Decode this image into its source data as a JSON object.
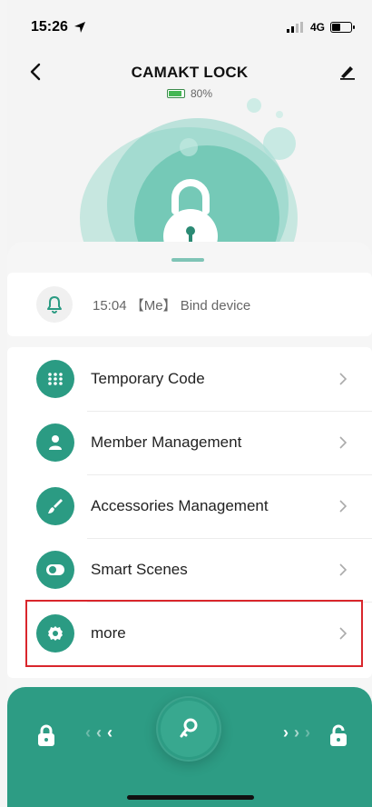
{
  "status": {
    "time": "15:26",
    "network": "4G"
  },
  "header": {
    "title": "CAMAKT LOCK",
    "battery_percent": "80%"
  },
  "notification": {
    "text": "15:04 【Me】 Bind device"
  },
  "menu": [
    {
      "label": "Temporary Code"
    },
    {
      "label": "Member Management"
    },
    {
      "label": "Accessories Management"
    },
    {
      "label": "Smart Scenes"
    },
    {
      "label": "more"
    }
  ],
  "colors": {
    "accent": "#2b9b83",
    "highlight": "#d9262c",
    "battery": "#45b754"
  },
  "icons": [
    "back-icon",
    "edit-icon",
    "battery-icon",
    "bell-icon",
    "keypad-icon",
    "person-icon",
    "brush-icon",
    "toggle-icon",
    "gear-icon",
    "chevron-right-icon",
    "lock-icon",
    "unlock-icon",
    "key-icon"
  ]
}
